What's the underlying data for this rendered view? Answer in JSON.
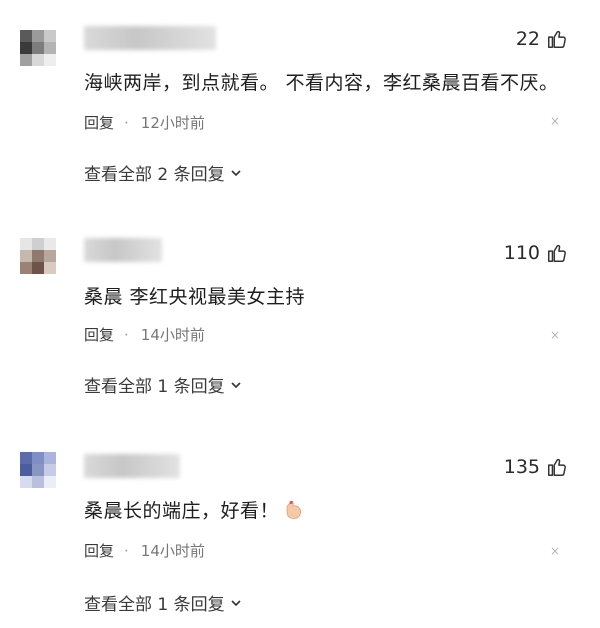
{
  "comments": [
    {
      "likes": "22",
      "text": "海峡两岸，到点就看。 不看内容，李红桑晨百看不厌。",
      "reply_label": "回复",
      "dot": "·",
      "time": "12小时前",
      "view_replies": "查看全部 2 条回复",
      "close": "×"
    },
    {
      "likes": "110",
      "text": "桑晨 李红央视最美女主持",
      "reply_label": "回复",
      "dot": "·",
      "time": "14小时前",
      "view_replies": "查看全部 1 条回复",
      "close": "×"
    },
    {
      "likes": "135",
      "text": "桑晨长的端庄，好看！",
      "emoji": "flexed-arm-emoji",
      "reply_label": "回复",
      "dot": "·",
      "time": "14小时前",
      "view_replies": "查看全部 1 条回复",
      "close": "×"
    }
  ],
  "icons": {
    "like": "thumbs-up-icon",
    "chevron": "chevron-down-icon",
    "close": "close-icon"
  },
  "colors": {
    "text": "#1e1e1e",
    "meta": "#777777",
    "background": "#ffffff"
  }
}
